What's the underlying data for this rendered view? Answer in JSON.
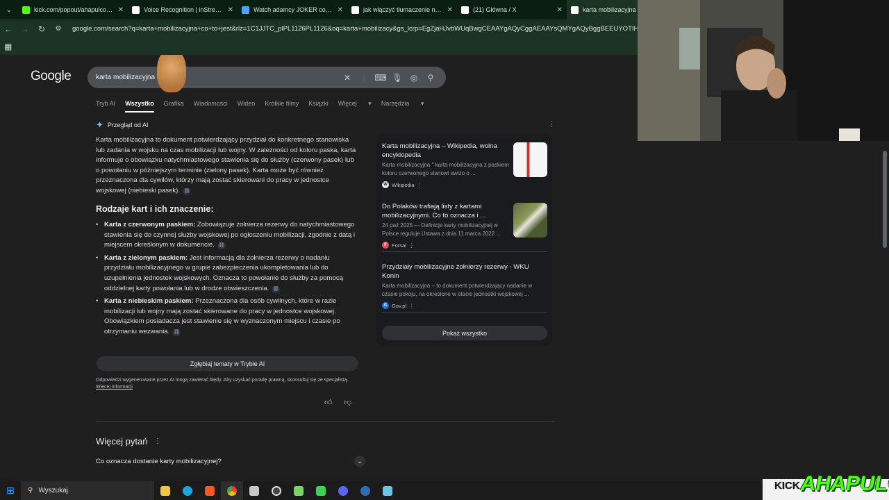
{
  "browser": {
    "tabs": [
      {
        "title": "kick.com/popout/ahapulco/chat",
        "icon": "kick-icon",
        "color": "#53fc18"
      },
      {
        "title": "Voice Recognition | inStream",
        "icon": "instream-icon",
        "color": "#ffffff"
      },
      {
        "title": "Watch adamcy JOKER cosplay",
        "icon": "watch-icon",
        "color": "#4aa3ff"
      },
      {
        "title": "jak włączyć tłumaczenie na żywo",
        "icon": "google-icon",
        "color": "#ffffff"
      },
      {
        "title": "(21) Główna / X",
        "icon": "x-icon",
        "color": "#ffffff"
      },
      {
        "title": "karta mobilizacyjna co",
        "icon": "google-icon",
        "color": "#ffffff"
      }
    ],
    "url": "google.com/search?q=karta+mobilizacyjna+co+to+jest&rlz=1C1JJTC_plPL1126PL1126&oq=karta+mobilizacy&gs_lcrp=EgZjaHJvbWUqBwgCEAAYgAQyCggAEAAYsQMYgAQyBggBEEUYOTIHCAIQABi"
  },
  "google": {
    "logo": "Google",
    "query": "karta mobilizacyjna co",
    "tabs": [
      "Tryb AI",
      "Wszystko",
      "Grafika",
      "Wiadomości",
      "Wideo",
      "Krótkie filmy",
      "Książki",
      "Więcej",
      "Narzędzia"
    ],
    "ai_overview": {
      "heading": "Przegląd od AI",
      "intro": "Karta mobilizacyjna to dokument potwierdzający przydział do konkretnego stanowiska lub zadania w wojsku na czas mobilizacji lub wojny. W zależności od koloru paska, karta informuje o obowiązku natychmiastowego stawienia się do służby (czerwony pasek) lub o powołaniu w późniejszym terminie (zielony pasek). Karta może być również przeznaczona dla cywilów, którzy mają zostać skierowani do pracy w jednostce wojskowej (niebieski pasek).",
      "subheading": "Rodzaje kart i ich znaczenie:",
      "bullets": [
        {
          "bold": "Karta z czerwonym paskiem:",
          "text": " Zobowiązuje żołnierza rezerwy do natychmiastowego stawienia się do czynnej służby wojskowej po ogłoszeniu mobilizacji, zgodnie z datą i miejscem określonym w dokumencie."
        },
        {
          "bold": "Karta z zielonym paskiem:",
          "text": " Jest informacją dla żołnierza rezerwy o nadaniu przydziału mobilizacyjnego w grupie zabezpieczenia ukompletowania lub do uzupełnienia jednostek wojskowych. Oznacza to powołanie do służby za pomocą oddzielnej karty powołania lub w drodze obwieszczenia."
        },
        {
          "bold": "Karta z niebieskim paskiem:",
          "text": " Przeznaczona dla osób cywilnych, które w razie mobilizacji lub wojny mają zostać skierowane do pracy w jednostce wojskowej. Obowiązkiem posiadacza jest stawienie się w wyznaczonym miejscu i czasie po otrzymaniu wezwania."
        }
      ],
      "deep_dive": "Zgłębiaj tematy w Trybie AI",
      "disclaimer": "Odpowiedzi wygenerowane przez AI mogą zawierać błędy. Aby uzyskać poradę prawną, skonsultuj się ze specjalistą.",
      "more_info": "Więcej informacji"
    },
    "sources": [
      {
        "title": "Karta mobilizacyjna – Wikipedia, wolna encyklopedia",
        "snippet": "Karta mobilizacyjna \" karta mobilizacyjna z paskiem koloru czerwonego stanowi awizo o ...",
        "source": "Wikipedia",
        "source_icon": "W"
      },
      {
        "title": "Do Polaków trafiają listy z kartami mobilizacyjnymi. Co to oznacza i ...",
        "snippet": "24 paź 2025 — Definicje karty mobilizacyjnej w Polsce reguluje Ustawa z dnia 11 marca 2022 ...",
        "source": "Forsal",
        "source_icon": "F"
      },
      {
        "title": "Przydziały mobilizacyjne żołnierzy rezerwy - WKU Konin",
        "snippet": "Karta mobilizacyjna – to dokument potwierdzający nadanie w czasie pokoju, na określone w etacie jednostki wojskowej ...",
        "source": "Gov.pl",
        "source_icon": "G"
      }
    ],
    "show_all": "Pokaż wszystko",
    "paa_title": "Więcej pytań",
    "paa_questions": [
      "Co oznacza dostanie karty mobilizacyjnej?"
    ]
  },
  "taskbar": {
    "search_placeholder": "Wyszukaj"
  },
  "overlay": {
    "kick_text": "KICK",
    "channel": "AHAPULCO"
  }
}
